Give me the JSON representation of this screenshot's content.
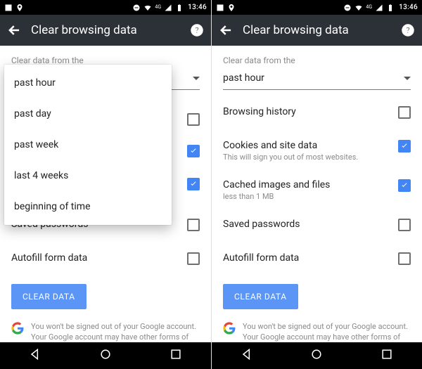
{
  "status": {
    "time": "13:46",
    "net": "4G"
  },
  "toolbar": {
    "title": "Clear browsing data"
  },
  "section_label": "Clear data from the",
  "dropdown": {
    "selected": "past hour",
    "options": [
      "past hour",
      "past day",
      "past week",
      "last 4 weeks",
      "beginning of time"
    ]
  },
  "rows": {
    "browsing": {
      "label": "Browsing history"
    },
    "cookies": {
      "label": "Cookies and site data",
      "sub": "This will sign you out of most websites."
    },
    "cache": {
      "label": "Cached images and files",
      "sub": "less than 1 MB"
    },
    "passwords": {
      "label": "Saved passwords"
    },
    "autofill": {
      "label": "Autofill form data"
    }
  },
  "button": {
    "clear": "CLEAR DATA"
  },
  "footer": "You won't be signed out of your Google account. Your Google account may have other forms of browsing history at"
}
